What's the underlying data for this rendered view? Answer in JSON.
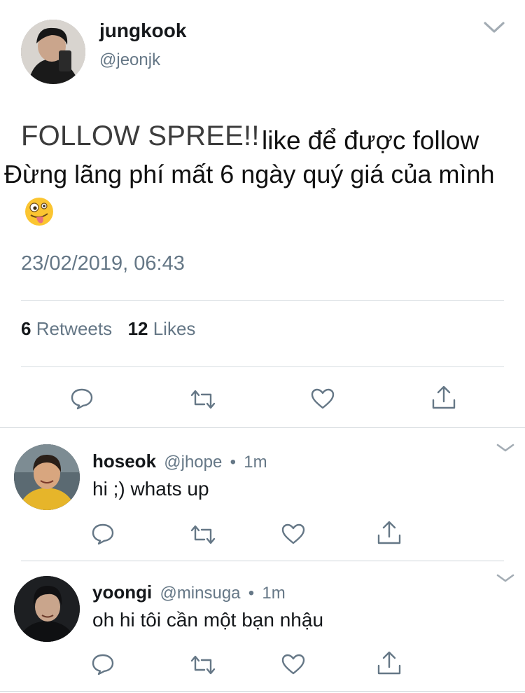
{
  "main_tweet": {
    "display_name": "jungkook",
    "handle": "@jeonjk",
    "text_part1": "FOLLOW SPREE!!",
    "text_part2": "like để được follow",
    "text_line2": "Đừng lãng phí mất 6 ngày quý giá của mình",
    "timestamp": "23/02/2019, 06:43",
    "retweets_count": "6",
    "retweets_label": "Retweets",
    "likes_count": "12",
    "likes_label": "Likes"
  },
  "replies": [
    {
      "display_name": "hoseok",
      "handle": "@jhope",
      "separator": "•",
      "time": "1m",
      "text": "hi ;) whats up"
    },
    {
      "display_name": "yoongi",
      "handle": "@minsuga",
      "separator": "•",
      "time": "1m",
      "text": "oh hi tôi cần một bạn nhậu"
    }
  ],
  "icons": {
    "reply": "reply-icon",
    "retweet": "retweet-icon",
    "like": "heart-icon",
    "share": "share-icon",
    "chevron": "chevron-down-icon",
    "emoji": "zany-face-emoji"
  },
  "colors": {
    "text": "#14171a",
    "secondary": "#657786",
    "divider": "#d9dee2"
  }
}
